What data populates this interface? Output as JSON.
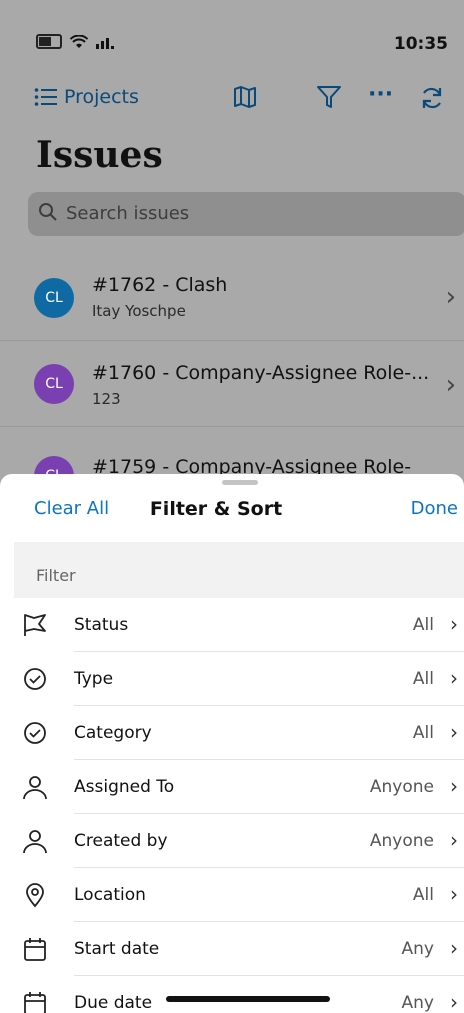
{
  "status_bar": {
    "time": "10:35"
  },
  "toolbar": {
    "projects_label": "Projects",
    "more_label": "···"
  },
  "page_title": "Issues",
  "search": {
    "placeholder": "Search issues"
  },
  "issues": [
    {
      "initials": "CL",
      "title": "#1762  -  Clash",
      "subtitle": "Itay Yoschpe",
      "color": "#0f6aa3"
    },
    {
      "initials": "CL",
      "title": "#1760  -  Company-Assignee Role-...",
      "subtitle": "123",
      "color": "#7a3fb0"
    },
    {
      "initials": "CL",
      "title": "#1759  -  Company-Assignee Role-",
      "subtitle": "",
      "color": "#7a3fb0"
    }
  ],
  "sheet": {
    "clear_all": "Clear All",
    "title": "Filter & Sort",
    "done": "Done",
    "section_label": "Filter",
    "rows": [
      {
        "icon": "flag-icon",
        "label": "Status",
        "value": "All"
      },
      {
        "icon": "check-circle-icon",
        "label": "Type",
        "value": "All"
      },
      {
        "icon": "check-circle-icon",
        "label": "Category",
        "value": "All"
      },
      {
        "icon": "person-icon",
        "label": "Assigned To",
        "value": "Anyone"
      },
      {
        "icon": "person-icon",
        "label": "Created by",
        "value": "Anyone"
      },
      {
        "icon": "location-pin-icon",
        "label": "Location",
        "value": "All"
      },
      {
        "icon": "calendar-icon",
        "label": "Start date",
        "value": "Any"
      },
      {
        "icon": "calendar-icon",
        "label": "Due date",
        "value": "Any"
      }
    ]
  },
  "colors": {
    "accent": "#0a74c9",
    "dim_overlay": "#a9a9a9"
  }
}
